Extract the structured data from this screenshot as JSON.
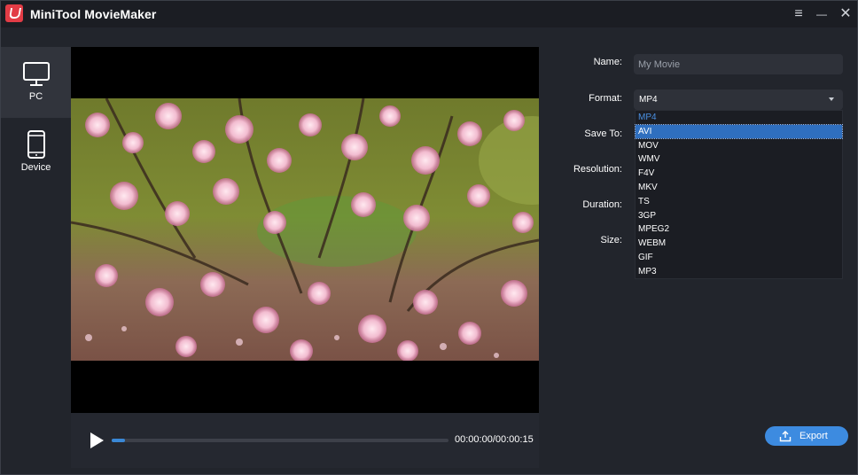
{
  "app": {
    "title": "MiniTool MovieMaker"
  },
  "window_controls": {
    "menu": "≡",
    "minimize": "—",
    "close": "✕"
  },
  "sidebar": {
    "items": [
      {
        "label": "PC",
        "icon": "monitor-icon",
        "active": true
      },
      {
        "label": "Device",
        "icon": "phone-icon",
        "active": false
      }
    ]
  },
  "player": {
    "time": "00:00:00/00:00:15",
    "progress": 0.04
  },
  "form": {
    "name_label": "Name:",
    "name_value": "My Movie",
    "format_label": "Format:",
    "format_value": "MP4",
    "save_to_label": "Save To:",
    "resolution_label": "Resolution:",
    "duration_label": "Duration:",
    "size_label": "Size:"
  },
  "format_options": [
    "MP4",
    "AVI",
    "MOV",
    "WMV",
    "F4V",
    "MKV",
    "TS",
    "3GP",
    "MPEG2",
    "WEBM",
    "GIF",
    "MP3"
  ],
  "format_selected_index": 0,
  "format_hover_index": 1,
  "export": {
    "label": "Export",
    "icon": "upload-icon"
  },
  "colors": {
    "accent": "#3d8be0",
    "background": "#22252c",
    "selected_option": "#4a90e2"
  }
}
